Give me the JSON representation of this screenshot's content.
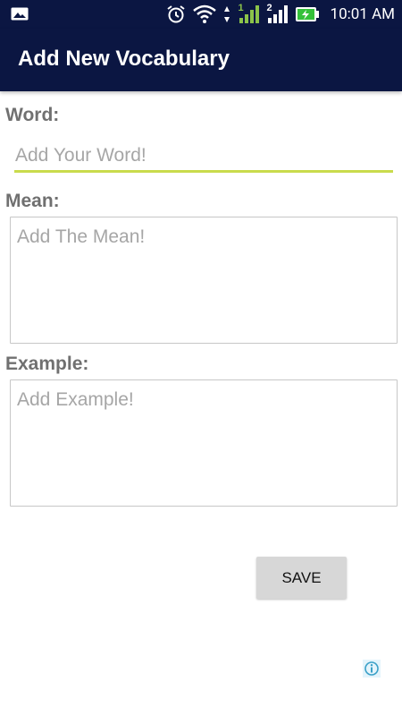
{
  "status_bar": {
    "time": "10:01 AM",
    "icons": [
      "image-icon",
      "alarm-icon",
      "wifi-icon",
      "signal-sim1-icon",
      "signal-sim2-icon",
      "battery-charging-icon"
    ],
    "sim1_label": "1",
    "sim2_label": "2"
  },
  "app_bar": {
    "title": "Add New Vocabulary",
    "color": "#0b1642"
  },
  "form": {
    "word_label": "Word:",
    "word_placeholder": "Add Your Word!",
    "word_value": "",
    "mean_label": "Mean:",
    "mean_placeholder": "Add The Mean!",
    "mean_value": "",
    "example_label": "Example:",
    "example_placeholder": "Add Example!",
    "example_value": "",
    "accent_color": "#c9db4c"
  },
  "actions": {
    "save_label": "SAVE"
  },
  "ad": {
    "icon": "info-icon"
  }
}
